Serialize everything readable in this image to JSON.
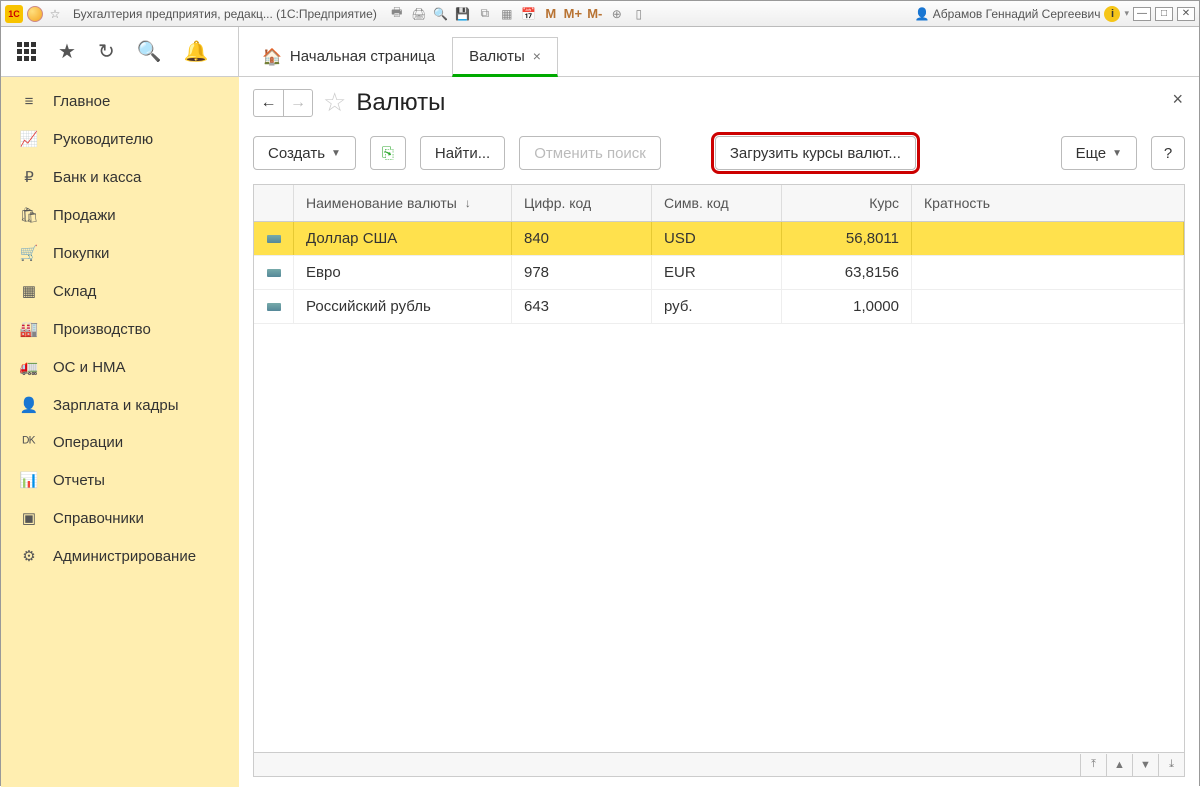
{
  "titlebar": {
    "logo_text": "1C",
    "title": "Бухгалтерия предприятия, редакц... (1С:Предприятие)",
    "m_buttons": [
      "M",
      "M+",
      "M-"
    ],
    "user_name": "Абрамов Геннадий Сергеевич"
  },
  "tabs": {
    "home": "Начальная страница",
    "active": "Валюты"
  },
  "sidebar": [
    {
      "icon": "≡",
      "label": "Главное"
    },
    {
      "icon": "📈",
      "label": "Руководителю"
    },
    {
      "icon": "₽",
      "label": "Банк и касса"
    },
    {
      "icon": "🛍",
      "label": "Продажи"
    },
    {
      "icon": "🛒",
      "label": "Покупки"
    },
    {
      "icon": "▦",
      "label": "Склад"
    },
    {
      "icon": "🏭",
      "label": "Производство"
    },
    {
      "icon": "🚛",
      "label": "ОС и НМА"
    },
    {
      "icon": "👤",
      "label": "Зарплата и кадры"
    },
    {
      "icon": "ᴰᴷ",
      "label": "Операции"
    },
    {
      "icon": "📊",
      "label": "Отчеты"
    },
    {
      "icon": "▣",
      "label": "Справочники"
    },
    {
      "icon": "⚙",
      "label": "Администрирование"
    }
  ],
  "page": {
    "title": "Валюты",
    "buttons": {
      "create": "Создать",
      "find": "Найти...",
      "cancel_search": "Отменить поиск",
      "load_rates": "Загрузить курсы валют...",
      "more": "Еще",
      "help": "?"
    }
  },
  "table": {
    "columns": [
      "Наименование валюты",
      "Цифр. код",
      "Симв. код",
      "Курс",
      "Кратность"
    ],
    "rows": [
      {
        "name": "Доллар США",
        "num": "840",
        "sym": "USD",
        "rate": "56,8011",
        "mult": "",
        "selected": true
      },
      {
        "name": "Евро",
        "num": "978",
        "sym": "EUR",
        "rate": "63,8156",
        "mult": "",
        "selected": false
      },
      {
        "name": "Российский рубль",
        "num": "643",
        "sym": "руб.",
        "rate": "1,0000",
        "mult": "",
        "selected": false
      }
    ]
  }
}
